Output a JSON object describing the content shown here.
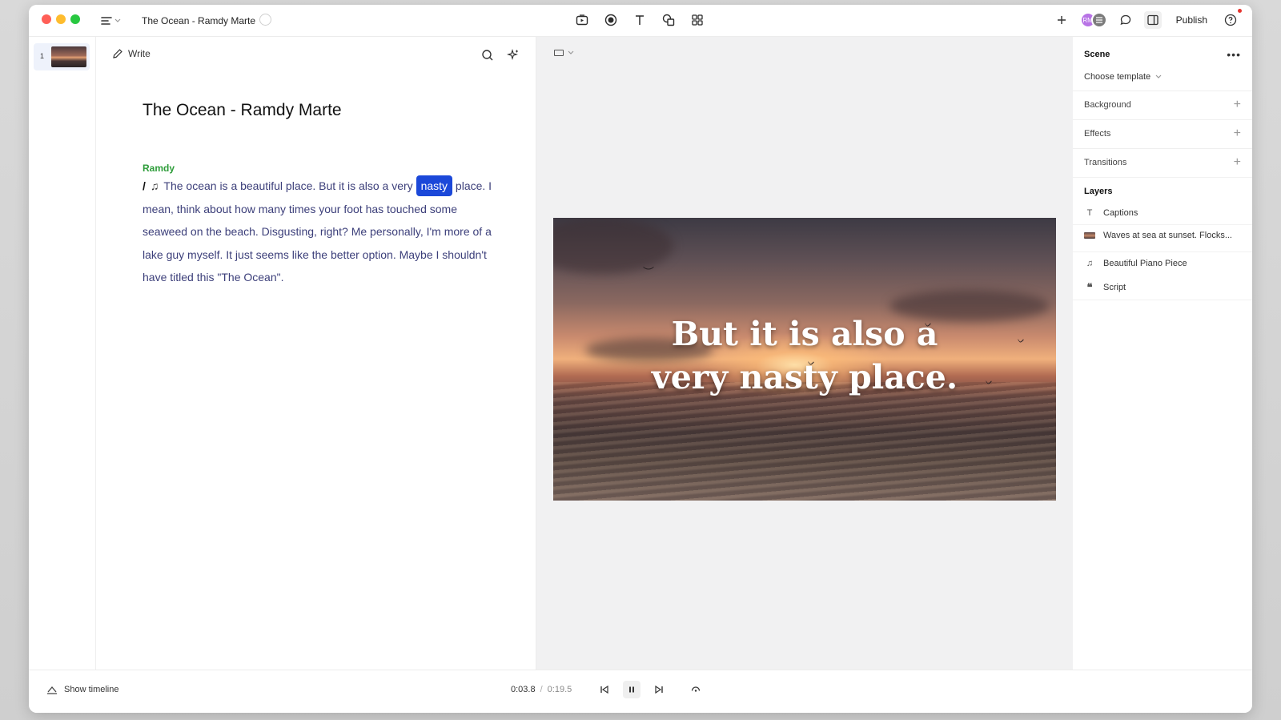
{
  "window": {
    "title": "The Ocean - Ramdy Marte",
    "publish_label": "Publish",
    "avatar_initials": "RM"
  },
  "sidebar": {
    "scenes": [
      {
        "number": "1"
      }
    ]
  },
  "script_panel": {
    "write_label": "Write",
    "title": "The Ocean - Ramdy Marte",
    "speaker": "Ramdy",
    "marker": "/",
    "text_before": "The ocean is a beautiful place. But it is also a very ",
    "highlighted_word": "nasty",
    "text_after": " place. I mean, think about how many times your foot has touched some seaweed on the beach. Disgusting, right? Me personally, I'm more of a lake guy myself. It just seems like the better option. Maybe I shouldn't have titled this \"The Ocean\".",
    "highlight_color": "#1b48d9",
    "speaker_color": "#2e9d3a"
  },
  "canvas": {
    "caption_line1": "But it is also a",
    "caption_line2": "very nasty place."
  },
  "inspector": {
    "heading": "Scene",
    "template_label": "Choose template",
    "sections": [
      {
        "label": "Background"
      },
      {
        "label": "Effects"
      },
      {
        "label": "Transitions"
      }
    ],
    "layers_heading": "Layers",
    "layers": [
      {
        "icon": "text-icon",
        "label": "Captions"
      },
      {
        "icon": "video-thumbnail",
        "label": "Waves at sea at sunset. Flocks..."
      },
      {
        "icon": "music-note-icon",
        "label": "Beautiful Piano Piece"
      },
      {
        "icon": "quote-icon",
        "label": "Script"
      }
    ]
  },
  "bottom_bar": {
    "show_timeline_label": "Show timeline",
    "current_time": "0:03.8",
    "separator": "/",
    "total_time": "0:19.5"
  }
}
